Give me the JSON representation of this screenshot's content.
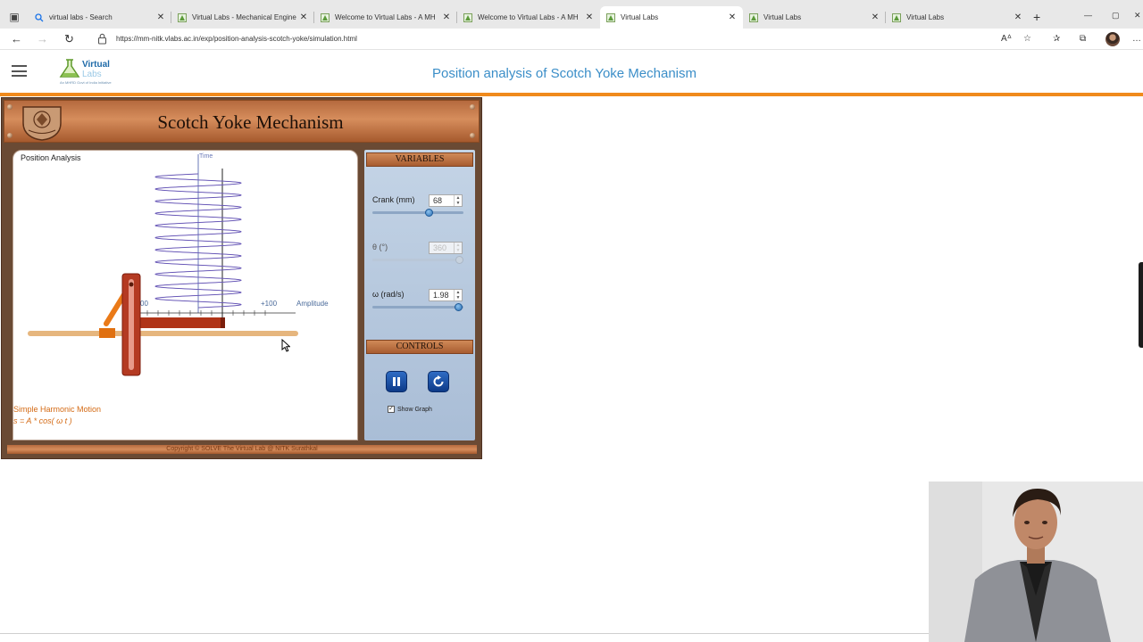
{
  "browser": {
    "tabs": [
      {
        "title": "virtual labs - Search",
        "icon": "search-icon"
      },
      {
        "title": "Virtual Labs - Mechanical Engine",
        "icon": "vlab-icon"
      },
      {
        "title": "Welcome to Virtual Labs - A MH",
        "icon": "vlab-icon"
      },
      {
        "title": "Welcome to Virtual Labs - A MH",
        "icon": "vlab-icon"
      },
      {
        "title": "Virtual Labs",
        "icon": "vlab-icon",
        "active": true
      },
      {
        "title": "Virtual Labs",
        "icon": "vlab-icon"
      },
      {
        "title": "Virtual Labs",
        "icon": "vlab-icon"
      }
    ],
    "url": "https://mm-nitk.vlabs.ac.in/exp/position-analysis-scotch-yoke/simulation.html"
  },
  "site": {
    "logo_line1": "Virtual",
    "logo_line2": "Labs",
    "logo_tagline": "An MHRD Govt of India Initiative",
    "page_title": "Position analysis of Scotch Yoke Mechanism"
  },
  "simulation": {
    "title": "Scotch Yoke Mechanism",
    "canvas_label": "Position Analysis",
    "axis_time": "Time",
    "axis_amplitude": "Amplitude",
    "tick_plus": "+100",
    "tick_minus": "00",
    "shm_title": "Simple Harmonic Motion",
    "shm_formula": "s = A * cos( ω t )",
    "variables_header": "VARIABLES",
    "crank_label": "Crank (mm)",
    "crank_value": "68",
    "crank_slider_fraction": 0.63,
    "theta_label": "θ (°)",
    "theta_value": "360",
    "theta_slider_fraction": 1.0,
    "omega_label": "ω (rad/s)",
    "omega_value": "1.98",
    "omega_slider_fraction": 0.99,
    "controls_header": "CONTROLS",
    "show_graph_label": "Show Graph",
    "show_graph_checked": true,
    "copyright": "Copyright © SOLVE The Virtual Lab @ NITK Surathkal"
  },
  "colors": {
    "accent_orange": "#f08a1c",
    "title_blue": "#3b8ec8",
    "shm_text": "#d46a14",
    "wave_purple": "#6a5ab8"
  }
}
